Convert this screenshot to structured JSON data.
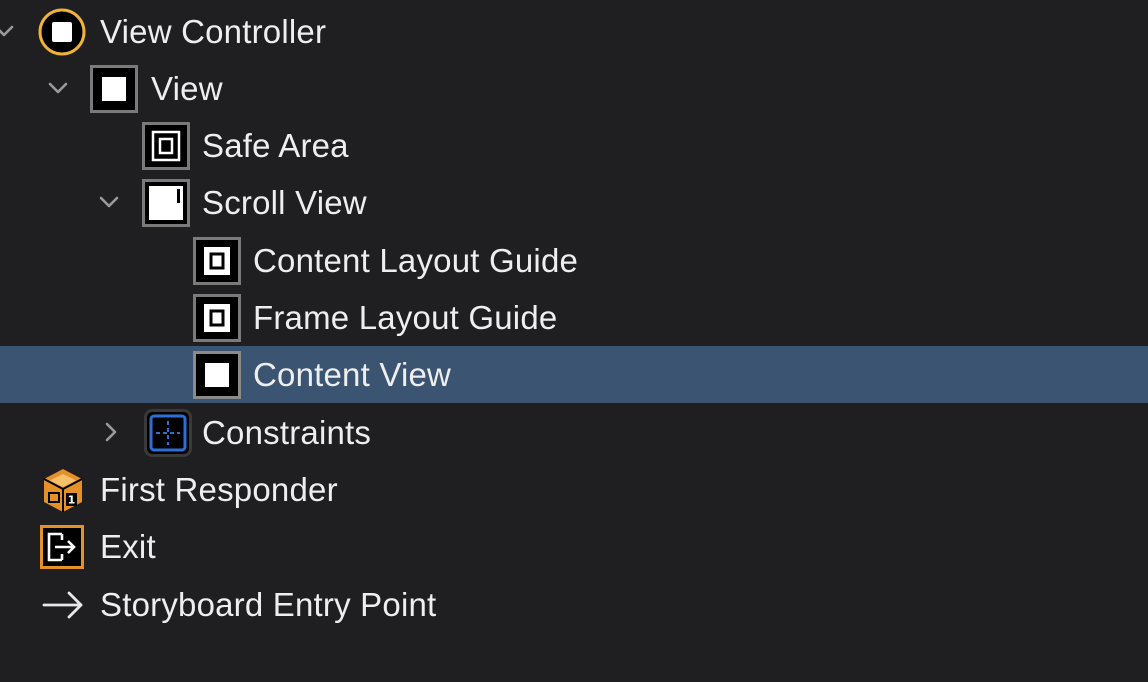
{
  "outline": {
    "rows": [
      {
        "label": "View Controller",
        "icon": "view-controller-icon",
        "disclosure": "expanded"
      },
      {
        "label": "View",
        "icon": "view-icon",
        "disclosure": "expanded"
      },
      {
        "label": "Safe Area",
        "icon": "safe-area-icon",
        "disclosure": "none"
      },
      {
        "label": "Scroll View",
        "icon": "scroll-view-icon",
        "disclosure": "expanded"
      },
      {
        "label": "Content Layout Guide",
        "icon": "layout-guide-icon",
        "disclosure": "none"
      },
      {
        "label": "Frame Layout Guide",
        "icon": "layout-guide-icon",
        "disclosure": "none"
      },
      {
        "label": "Content View",
        "icon": "view-icon",
        "disclosure": "none",
        "selected": true
      },
      {
        "label": "Constraints",
        "icon": "constraints-icon",
        "disclosure": "collapsed"
      },
      {
        "label": "First Responder",
        "icon": "first-responder-icon",
        "disclosure": "none"
      },
      {
        "label": "Exit",
        "icon": "exit-icon",
        "disclosure": "none"
      },
      {
        "label": "Storyboard Entry Point",
        "icon": "arrow-right-icon",
        "disclosure": "none"
      }
    ]
  },
  "colors": {
    "background": "#1f1f21",
    "selection": "#3a5471",
    "text": "#eeeeee",
    "view-controller-accent": "#f0b33a",
    "orange-accent": "#e6902a",
    "constraints-blue": "#2e6fd6"
  }
}
